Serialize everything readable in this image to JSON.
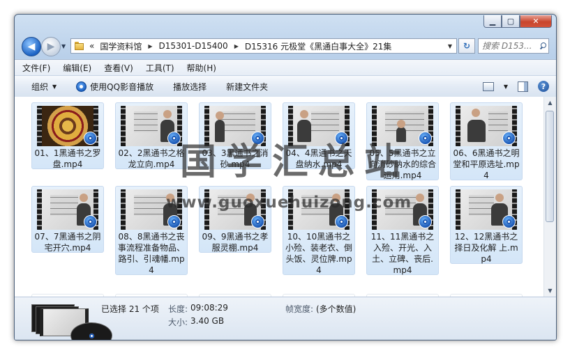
{
  "address": {
    "crumbs": [
      "国学资料馆",
      "D15301-D15400",
      "D15316 元极堂《黑通白事大全》21集"
    ],
    "overflow": "«"
  },
  "search": {
    "placeholder": "搜索 D153..."
  },
  "window_buttons": {
    "minimize": "▁",
    "maximize": "▢",
    "close": "✕"
  },
  "menu": [
    "文件(F)",
    "编辑(E)",
    "查看(V)",
    "工具(T)",
    "帮助(H)"
  ],
  "toolbar": {
    "organize": "组织",
    "qq_play": "使用QQ影音播放",
    "play_selection": "播放选择",
    "new_folder": "新建文件夹"
  },
  "files": [
    {
      "name": "01、1黑通书之罗盘.mp4",
      "thumb": "compass"
    },
    {
      "name": "02、2黑通书之格龙立向.mp4",
      "thumb": "board"
    },
    {
      "name": "03、3黑通书之消砂.mp4",
      "thumb": "board"
    },
    {
      "name": "04、4黑通书之天盘纳水.mp4",
      "thumb": "board"
    },
    {
      "name": "05、5黑通书之立向消砂纳水的综合运用.mp4",
      "thumb": "board"
    },
    {
      "name": "06、6黑通书之明堂和平原选址.mp4",
      "thumb": "board"
    },
    {
      "name": "07、7黑通书之阴宅开穴.mp4",
      "thumb": "board"
    },
    {
      "name": "08、8黑通书之丧事流程准备物品、路引、引魂幡.mp4",
      "thumb": "board"
    },
    {
      "name": "09、9黑通书之孝服灵棚.mp4",
      "thumb": "board"
    },
    {
      "name": "10、10黑通书之小殓、装老衣、倒头饭、灵位牌.mp4",
      "thumb": "board"
    },
    {
      "name": "11、11黑通书之入殓、开光、入土、立碑、丧后.mp4",
      "thumb": "board"
    },
    {
      "name": "12、12黑通书之择日及化解 上.mp4",
      "thumb": "board"
    }
  ],
  "watermark": {
    "text": "国学汇总站",
    "url": "www.guoxuehuizong.com"
  },
  "status": {
    "selected": "已选择 21 个项",
    "length_label": "长度:",
    "length_value": "09:08:29",
    "size_label": "大小:",
    "size_value": "3.40 GB",
    "width_label": "帧宽度:",
    "width_value": "(多个数值)"
  }
}
